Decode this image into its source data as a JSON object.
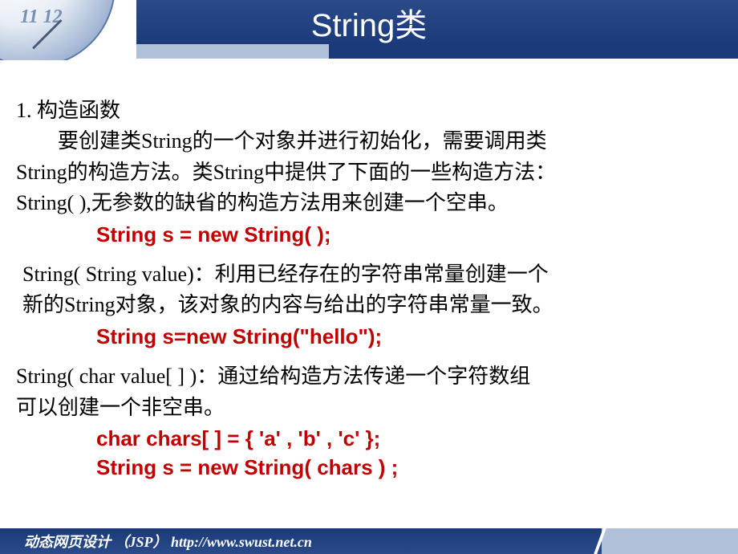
{
  "header": {
    "title": "String类",
    "clock_numbers": "11  12"
  },
  "content": {
    "heading": "1. 构造函数",
    "intro_line1": "要创建类String的一个对象并进行初始化，需要调用类",
    "intro_line2": "String的构造方法。类String中提供了下面的一些构造方法：",
    "ctor1_desc": "String( ),无参数的缺省的构造方法用来创建一个空串。",
    "ctor1_code": "String s = new String( );",
    "ctor2_line1": "String( String value)：利用已经存在的字符串常量创建一个",
    "ctor2_line2": "新的String对象，该对象的内容与给出的字符串常量一致。",
    "ctor2_code": "String s=new String(\"hello\");",
    "ctor3_line1": "String( char value[ ] )：通过给构造方法传递一个字符数组",
    "ctor3_line2": "可以创建一个非空串。",
    "ctor3_code1": "char chars[ ] = { 'a' , 'b' , 'c' };",
    "ctor3_code2": "String s = new String( chars ) ;"
  },
  "footer": {
    "text": "动态网页设计 （JSP） http://www.swust.net.cn"
  }
}
